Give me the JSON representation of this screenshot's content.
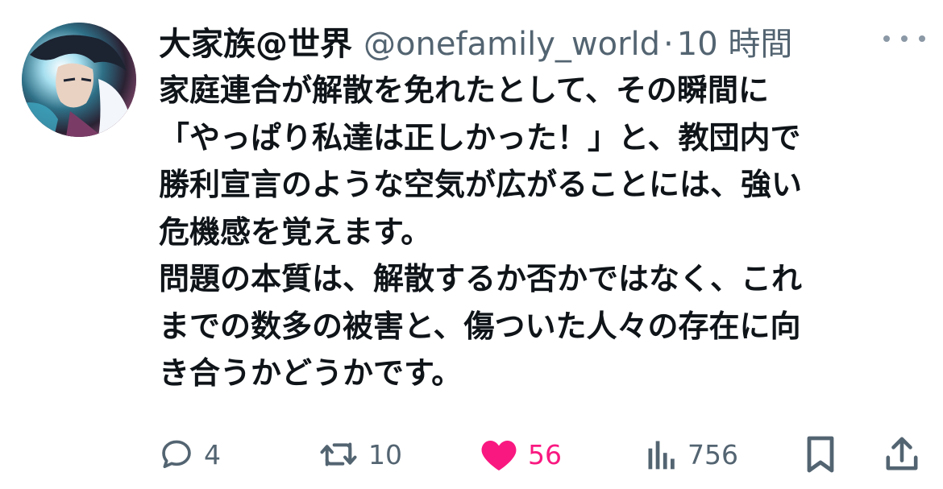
{
  "author": {
    "display_name": "大家族@世界",
    "handle": "@onefamily_world",
    "separator": "·",
    "time": "10 時間"
  },
  "tweet": {
    "lines": [
      "家庭連合が解散を免れたとして、その瞬間に",
      "「やっぱり私達は正しかった！」と、教団内で",
      "勝利宣言のような空気が広がることには、強い",
      "危機感を覚えます。",
      "問題の本質は、解散するか否かではなく、これ",
      "までの数多の被害と、傷ついた人々の存在に向",
      "き合うかどうかです。"
    ]
  },
  "actions": {
    "reply": {
      "icon": "reply-icon",
      "count": "4"
    },
    "retweet": {
      "icon": "retweet-icon",
      "count": "10"
    },
    "like": {
      "icon": "heart-icon",
      "count": "56",
      "liked": true
    },
    "views": {
      "icon": "views-icon",
      "count": "756"
    },
    "bookmark": {
      "icon": "bookmark-icon"
    },
    "share": {
      "icon": "share-icon"
    }
  },
  "colors": {
    "text_primary": "#0f1419",
    "text_secondary": "#536471",
    "like_active": "#f91880"
  }
}
